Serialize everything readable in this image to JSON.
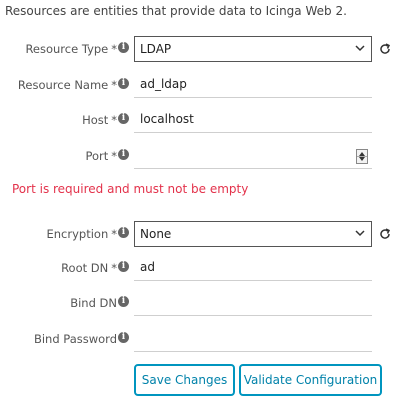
{
  "intro": "Resources are entities that provide data to Icinga Web 2.",
  "info_icon_glyph": "i",
  "fields": {
    "resource_type": {
      "label": "Resource Type",
      "required": "*",
      "value": "LDAP"
    },
    "resource_name": {
      "label": "Resource Name",
      "required": "*",
      "value": "ad_ldap"
    },
    "host": {
      "label": "Host",
      "required": "*",
      "value": "localhost"
    },
    "port": {
      "label": "Port",
      "required": "*",
      "value": ""
    },
    "encryption": {
      "label": "Encryption",
      "required": "*",
      "value": "None"
    },
    "root_dn": {
      "label": "Root DN",
      "required": "*",
      "value": "ad"
    },
    "bind_dn": {
      "label": "Bind DN",
      "value": ""
    },
    "bind_password": {
      "label": "Bind Password",
      "value": ""
    }
  },
  "port_error": "Port is required and must not be empty",
  "buttons": {
    "save": "Save Changes",
    "validate": "Validate Configuration"
  },
  "colors": {
    "accent": "#0095bf",
    "error": "#e3324b"
  },
  "icons": [
    "info-icon",
    "chevron-down-icon",
    "refresh-icon",
    "spinner-icon"
  ]
}
